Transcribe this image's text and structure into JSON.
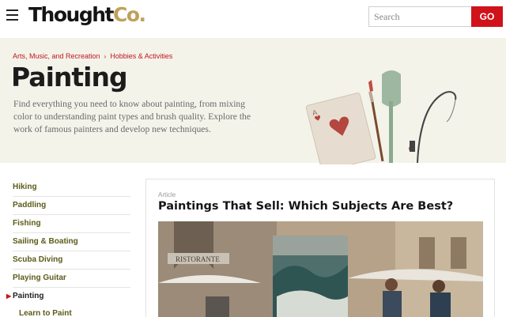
{
  "header": {
    "logo_main": "Thought",
    "logo_accent": "Co.",
    "search_placeholder": "Search",
    "go_label": "GO"
  },
  "breadcrumb": {
    "items": [
      "Arts, Music, and Recreation",
      "Hobbies & Activities"
    ],
    "separator": "›"
  },
  "hero": {
    "title": "Painting",
    "description": "Find everything you need to know about painting, from mixing color to understanding paint types and brush quality. Explore the work of famous painters and develop new techniques."
  },
  "sidebar": {
    "items": [
      {
        "label": "Hiking"
      },
      {
        "label": "Paddling"
      },
      {
        "label": "Fishing"
      },
      {
        "label": "Sailing & Boating"
      },
      {
        "label": "Scuba Diving"
      },
      {
        "label": "Playing Guitar"
      },
      {
        "label": "Painting"
      }
    ],
    "sub_items": [
      {
        "label": "Learn to Paint"
      }
    ]
  },
  "article": {
    "tag": "Article",
    "title": "Paintings That Sell: Which Subjects Are Best?",
    "image_sign": "RISTORANTE"
  },
  "colors": {
    "accent_red": "#d0121b",
    "logo_gold": "#bfa15c",
    "hero_bg": "#f3f3ea",
    "sidebar_text": "#5c5b1a"
  },
  "icons": {
    "menu": "hamburger-icon",
    "active_marker": "triangle-right-icon"
  }
}
